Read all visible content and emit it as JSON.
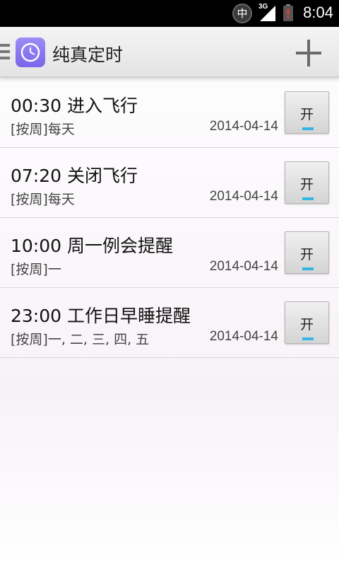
{
  "status_bar": {
    "ime": "中",
    "network_type": "3G",
    "time": "8:04"
  },
  "action_bar": {
    "title": "纯真定时",
    "icons": [
      "menu-icon",
      "clock-icon",
      "plus-icon"
    ]
  },
  "alarms": [
    {
      "title": "00:30 进入飞行",
      "repeat": "[按周]每天",
      "date": "2014-04-14",
      "toggle_label": "开"
    },
    {
      "title": "07:20 关闭飞行",
      "repeat": "[按周]每天",
      "date": "2014-04-14",
      "toggle_label": "开"
    },
    {
      "title": "10:00 周一例会提醒",
      "repeat": "[按周]一",
      "date": "2014-04-14",
      "toggle_label": "开"
    },
    {
      "title": "23:00 工作日早睡提醒",
      "repeat": "[按周]一, 二, 三, 四, 五",
      "date": "2014-04-14",
      "toggle_label": "开"
    }
  ],
  "colors": {
    "accent": "#33b5e5",
    "app_icon": "#8a78f0",
    "status_bar": "#000000"
  }
}
